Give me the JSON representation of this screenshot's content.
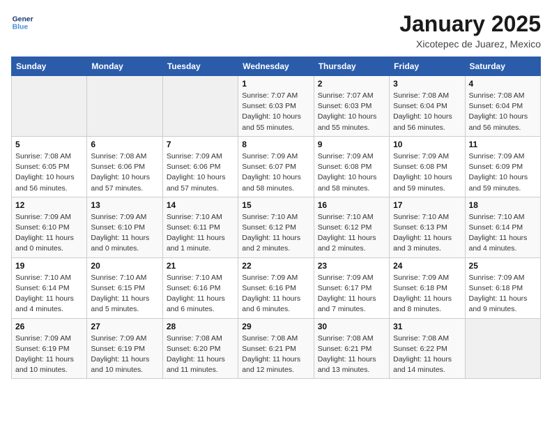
{
  "logo": {
    "line1": "General",
    "line2": "Blue"
  },
  "title": "January 2025",
  "subtitle": "Xicotepec de Juarez, Mexico",
  "weekdays": [
    "Sunday",
    "Monday",
    "Tuesday",
    "Wednesday",
    "Thursday",
    "Friday",
    "Saturday"
  ],
  "weeks": [
    [
      {
        "day": "",
        "info": ""
      },
      {
        "day": "",
        "info": ""
      },
      {
        "day": "",
        "info": ""
      },
      {
        "day": "1",
        "info": "Sunrise: 7:07 AM\nSunset: 6:03 PM\nDaylight: 10 hours and 55 minutes."
      },
      {
        "day": "2",
        "info": "Sunrise: 7:07 AM\nSunset: 6:03 PM\nDaylight: 10 hours and 55 minutes."
      },
      {
        "day": "3",
        "info": "Sunrise: 7:08 AM\nSunset: 6:04 PM\nDaylight: 10 hours and 56 minutes."
      },
      {
        "day": "4",
        "info": "Sunrise: 7:08 AM\nSunset: 6:04 PM\nDaylight: 10 hours and 56 minutes."
      }
    ],
    [
      {
        "day": "5",
        "info": "Sunrise: 7:08 AM\nSunset: 6:05 PM\nDaylight: 10 hours and 56 minutes."
      },
      {
        "day": "6",
        "info": "Sunrise: 7:08 AM\nSunset: 6:06 PM\nDaylight: 10 hours and 57 minutes."
      },
      {
        "day": "7",
        "info": "Sunrise: 7:09 AM\nSunset: 6:06 PM\nDaylight: 10 hours and 57 minutes."
      },
      {
        "day": "8",
        "info": "Sunrise: 7:09 AM\nSunset: 6:07 PM\nDaylight: 10 hours and 58 minutes."
      },
      {
        "day": "9",
        "info": "Sunrise: 7:09 AM\nSunset: 6:08 PM\nDaylight: 10 hours and 58 minutes."
      },
      {
        "day": "10",
        "info": "Sunrise: 7:09 AM\nSunset: 6:08 PM\nDaylight: 10 hours and 59 minutes."
      },
      {
        "day": "11",
        "info": "Sunrise: 7:09 AM\nSunset: 6:09 PM\nDaylight: 10 hours and 59 minutes."
      }
    ],
    [
      {
        "day": "12",
        "info": "Sunrise: 7:09 AM\nSunset: 6:10 PM\nDaylight: 11 hours and 0 minutes."
      },
      {
        "day": "13",
        "info": "Sunrise: 7:09 AM\nSunset: 6:10 PM\nDaylight: 11 hours and 0 minutes."
      },
      {
        "day": "14",
        "info": "Sunrise: 7:10 AM\nSunset: 6:11 PM\nDaylight: 11 hours and 1 minute."
      },
      {
        "day": "15",
        "info": "Sunrise: 7:10 AM\nSunset: 6:12 PM\nDaylight: 11 hours and 2 minutes."
      },
      {
        "day": "16",
        "info": "Sunrise: 7:10 AM\nSunset: 6:12 PM\nDaylight: 11 hours and 2 minutes."
      },
      {
        "day": "17",
        "info": "Sunrise: 7:10 AM\nSunset: 6:13 PM\nDaylight: 11 hours and 3 minutes."
      },
      {
        "day": "18",
        "info": "Sunrise: 7:10 AM\nSunset: 6:14 PM\nDaylight: 11 hours and 4 minutes."
      }
    ],
    [
      {
        "day": "19",
        "info": "Sunrise: 7:10 AM\nSunset: 6:14 PM\nDaylight: 11 hours and 4 minutes."
      },
      {
        "day": "20",
        "info": "Sunrise: 7:10 AM\nSunset: 6:15 PM\nDaylight: 11 hours and 5 minutes."
      },
      {
        "day": "21",
        "info": "Sunrise: 7:10 AM\nSunset: 6:16 PM\nDaylight: 11 hours and 6 minutes."
      },
      {
        "day": "22",
        "info": "Sunrise: 7:09 AM\nSunset: 6:16 PM\nDaylight: 11 hours and 6 minutes."
      },
      {
        "day": "23",
        "info": "Sunrise: 7:09 AM\nSunset: 6:17 PM\nDaylight: 11 hours and 7 minutes."
      },
      {
        "day": "24",
        "info": "Sunrise: 7:09 AM\nSunset: 6:18 PM\nDaylight: 11 hours and 8 minutes."
      },
      {
        "day": "25",
        "info": "Sunrise: 7:09 AM\nSunset: 6:18 PM\nDaylight: 11 hours and 9 minutes."
      }
    ],
    [
      {
        "day": "26",
        "info": "Sunrise: 7:09 AM\nSunset: 6:19 PM\nDaylight: 11 hours and 10 minutes."
      },
      {
        "day": "27",
        "info": "Sunrise: 7:09 AM\nSunset: 6:19 PM\nDaylight: 11 hours and 10 minutes."
      },
      {
        "day": "28",
        "info": "Sunrise: 7:08 AM\nSunset: 6:20 PM\nDaylight: 11 hours and 11 minutes."
      },
      {
        "day": "29",
        "info": "Sunrise: 7:08 AM\nSunset: 6:21 PM\nDaylight: 11 hours and 12 minutes."
      },
      {
        "day": "30",
        "info": "Sunrise: 7:08 AM\nSunset: 6:21 PM\nDaylight: 11 hours and 13 minutes."
      },
      {
        "day": "31",
        "info": "Sunrise: 7:08 AM\nSunset: 6:22 PM\nDaylight: 11 hours and 14 minutes."
      },
      {
        "day": "",
        "info": ""
      }
    ]
  ]
}
